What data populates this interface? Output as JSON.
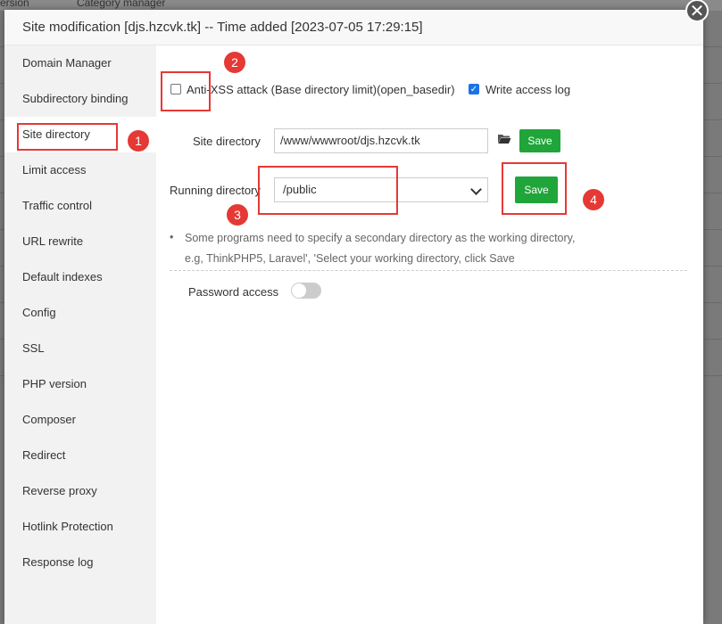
{
  "backdrop": {
    "top_left_text": "ersion",
    "top_dropdown_text": "Category manager"
  },
  "modal": {
    "title": "Site modification [djs.hzcvk.tk] -- Time added [2023-07-05 17:29:15]",
    "close_glyph": "✕"
  },
  "sidebar": {
    "items": [
      {
        "label": "Domain Manager"
      },
      {
        "label": "Subdirectory binding"
      },
      {
        "label": "Site directory"
      },
      {
        "label": "Limit access"
      },
      {
        "label": "Traffic control"
      },
      {
        "label": "URL rewrite"
      },
      {
        "label": "Default indexes"
      },
      {
        "label": "Config"
      },
      {
        "label": "SSL"
      },
      {
        "label": "PHP version"
      },
      {
        "label": "Composer"
      },
      {
        "label": "Redirect"
      },
      {
        "label": "Reverse proxy"
      },
      {
        "label": "Hotlink Protection"
      },
      {
        "label": "Response log"
      }
    ],
    "active_index": 2
  },
  "content": {
    "anti_xss": {
      "label": "Anti-XSS attack (Base directory limit)(open_basedir)",
      "checked": false
    },
    "access_log": {
      "label": "Write access log",
      "checked": true
    },
    "site_directory": {
      "label": "Site directory",
      "value": "/www/wwwroot/djs.hzcvk.tk",
      "button": "Save"
    },
    "running_directory": {
      "label": "Running directory",
      "value": "/public",
      "button": "Save"
    },
    "hint_line1": "Some programs need to specify a secondary directory as the working directory,",
    "hint_line2": "e.g, ThinkPHP5, Laravel', 'Select your working directory, click Save",
    "password_access": {
      "label": "Password access",
      "enabled": false
    }
  },
  "annotations": {
    "badges": [
      "1",
      "2",
      "3",
      "4"
    ]
  },
  "colors": {
    "primary_button": "#20a53a",
    "annotation_red": "#e53935",
    "checkbox_blue": "#1a73e8"
  }
}
